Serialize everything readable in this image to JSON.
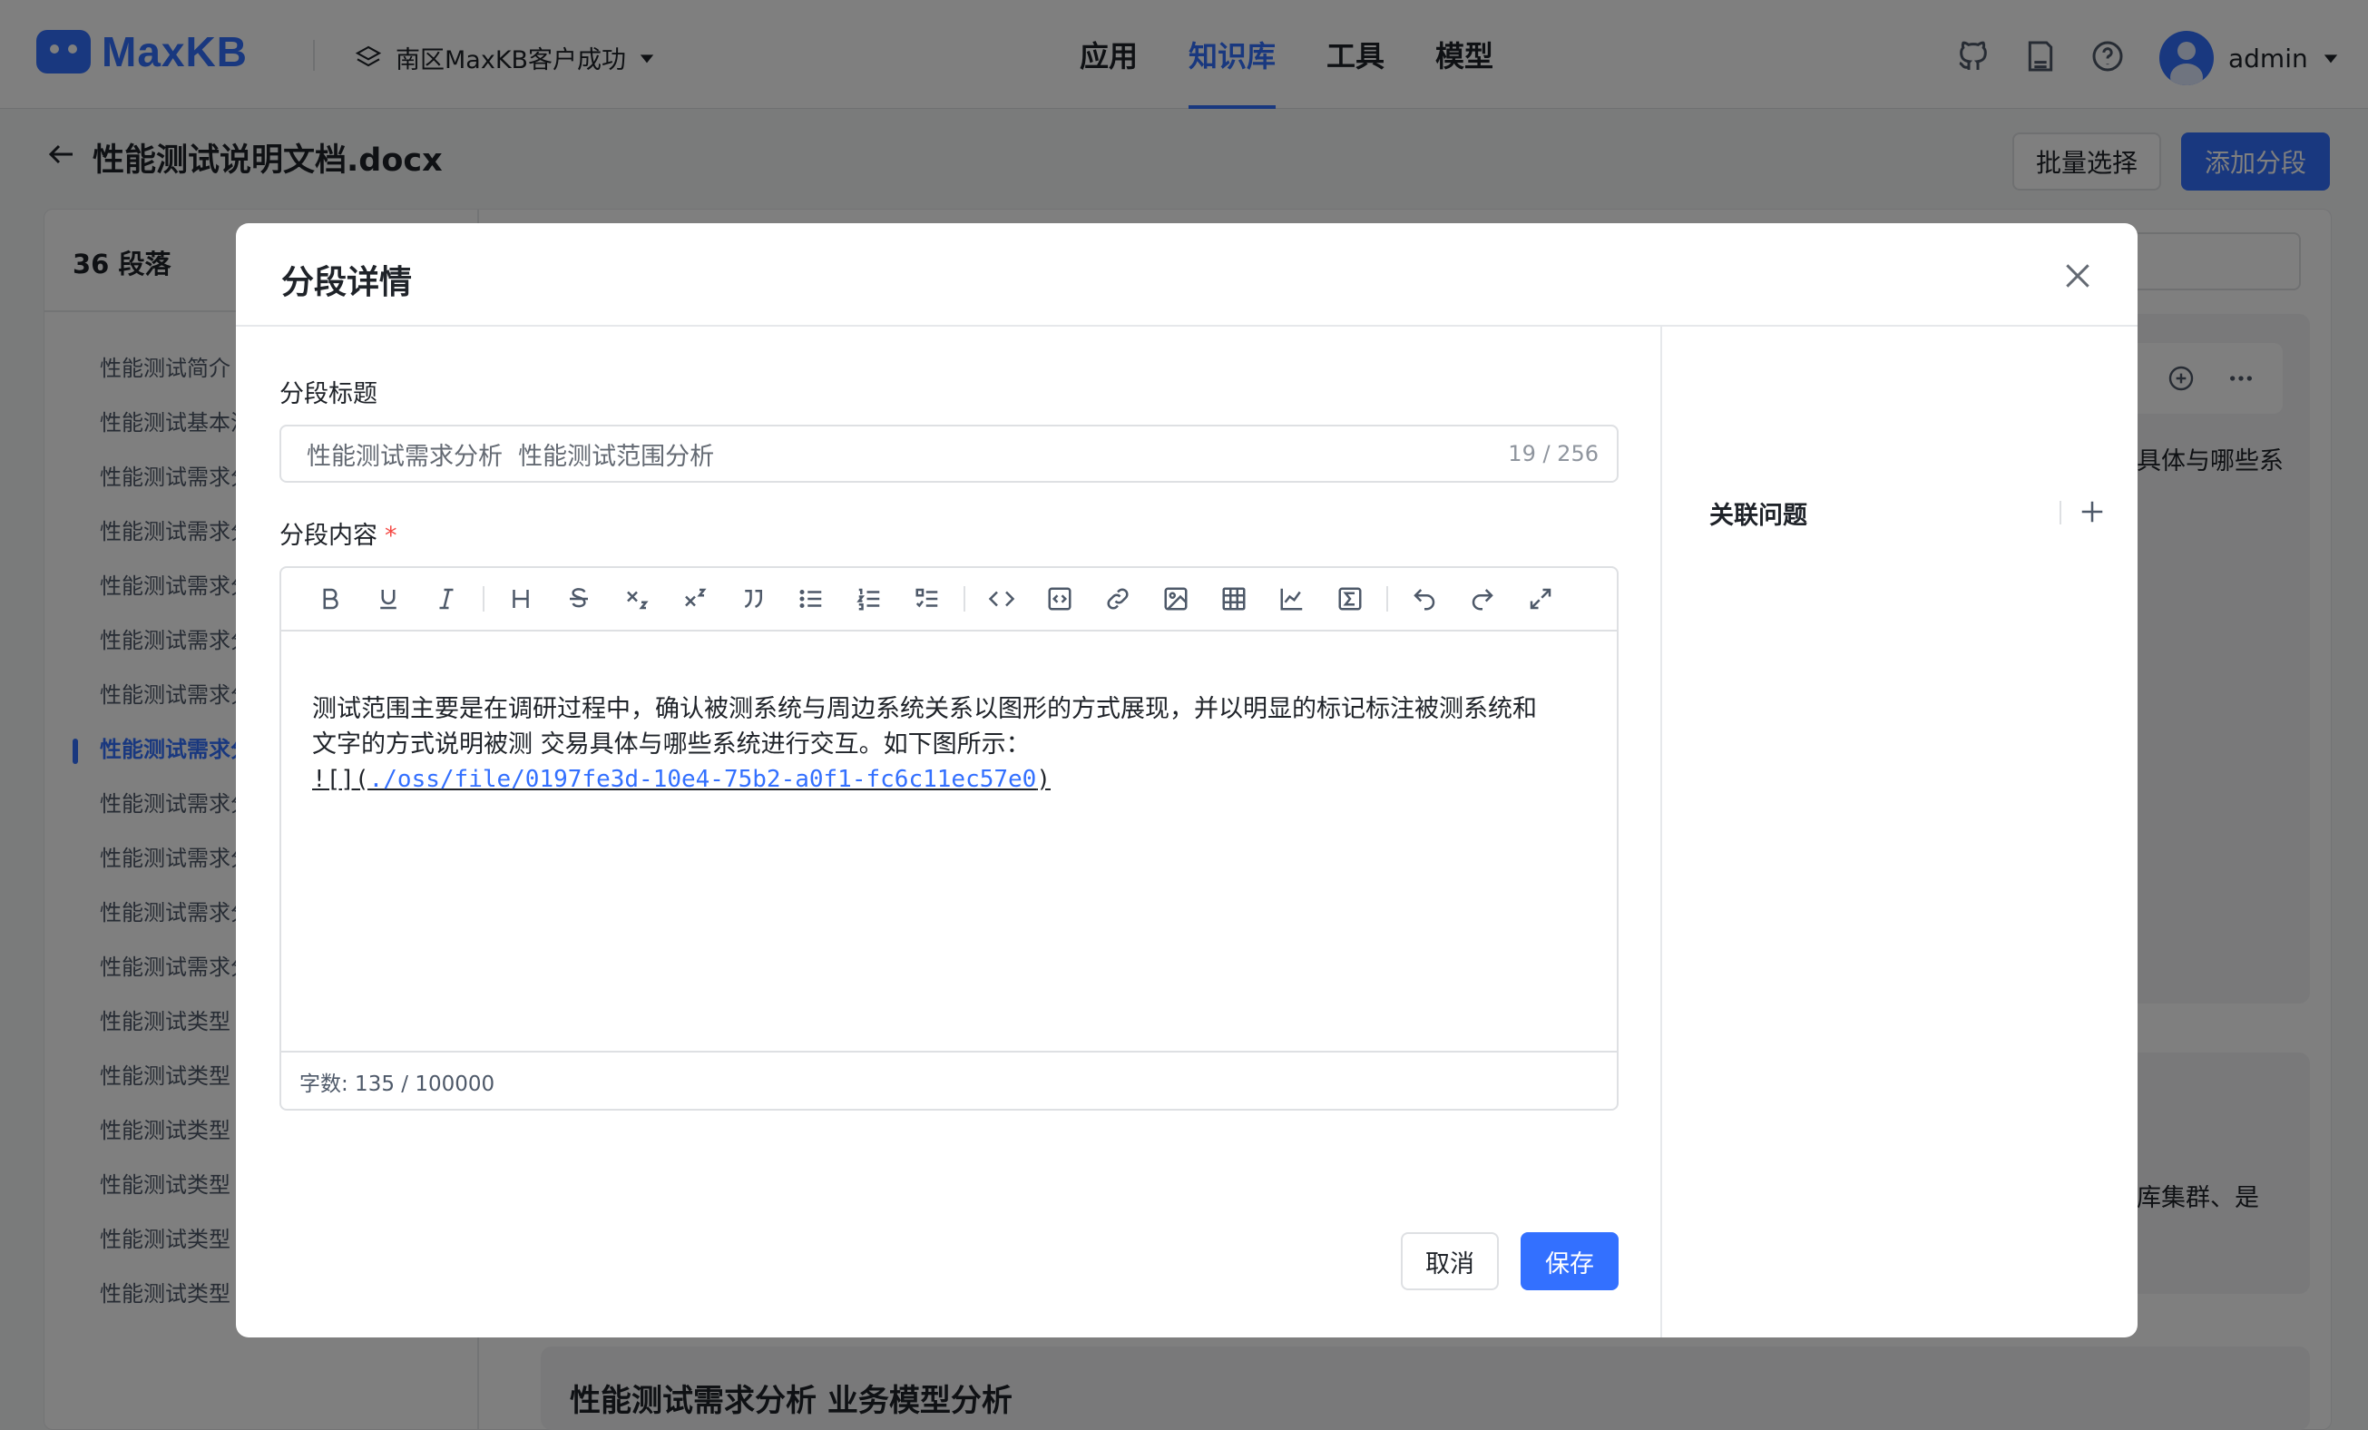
{
  "app": {
    "logo_text": "MaxKB",
    "workspace": "南区MaxKB客户成功",
    "nav": [
      "应用",
      "知识库",
      "工具",
      "模型"
    ],
    "nav_active_index": 1,
    "user_name": "admin"
  },
  "page": {
    "doc_title": "性能测试说明文档.docx",
    "batch_select_label": "批量选择",
    "add_segment_label": "添加分段",
    "paragraph_count": "36 段落",
    "toc": [
      "性能测试简介",
      "性能测试基本流",
      "性能测试需求分",
      "性能测试需求分",
      "性能测试需求分",
      "性能测试需求分",
      "性能测试需求分",
      "性能测试需求分",
      "性能测试需求分",
      "性能测试需求分",
      "性能测试需求分",
      "性能测试需求分",
      "性能测试类型",
      "性能测试类型",
      "性能测试类型",
      "性能测试类型",
      "性能测试类型",
      "性能测试类型"
    ],
    "toc_active_index": 7,
    "segment_preview_1": "具体与哪些系",
    "segment_preview_2": "库集群、是",
    "segment_title_3": "性能测试需求分析 业务模型分析"
  },
  "dialog": {
    "title": "分段详情",
    "segment_title_label": "分段标题",
    "segment_title_value": "性能测试需求分析  性能测试范围分析",
    "segment_title_counter": "19 / 256",
    "segment_content_label": "分段内容",
    "required_mark": "*",
    "content_line_1": "测试范围主要是在调研过程中，确认被测系统与周边系统关系以图形的方式展现，并以明显的标记标注被测系统和",
    "content_line_2": "文字的方式说明被测  交易具体与哪些系统进行交互。如下图所示：",
    "content_image_prefix": "![](",
    "content_image_link": "./oss/file/0197fe3d-10e4-75b2-a0f1-fc6c11ec57e0",
    "content_image_suffix": ")",
    "word_count": "字数: 135 / 100000",
    "cancel_label": "取消",
    "save_label": "保存",
    "related_questions_label": "关联问题"
  },
  "toolbar_icons": [
    "bold-icon",
    "underline-icon",
    "italic-icon",
    "heading-icon",
    "strikethrough-icon",
    "subscript-icon",
    "superscript-icon",
    "quote-icon",
    "bullet-list-icon",
    "ordered-list-icon",
    "task-list-icon",
    "code-icon",
    "code-block-icon",
    "link-icon",
    "image-icon",
    "table-icon",
    "chart-icon",
    "formula-icon",
    "undo-icon",
    "redo-icon",
    "fullscreen-icon"
  ],
  "colors": {
    "primary": "#3370ff",
    "required": "#f54a45",
    "mask": "rgba(0,0,0,0.5)"
  }
}
